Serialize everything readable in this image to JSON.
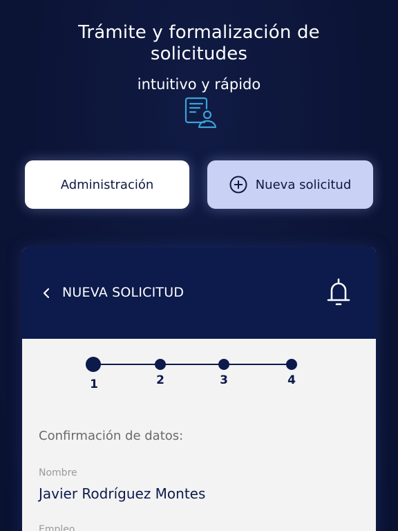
{
  "hero": {
    "title_line1": "Trámite y formalización de",
    "title_line2": "solicitudes",
    "subtitle": "intuitivo y rápido",
    "icon": "document-user-icon"
  },
  "actions": {
    "admin_label": "Administración",
    "new_label": "Nueva solicitud",
    "new_icon": "plus-circle-icon"
  },
  "card": {
    "header_title": "NUEVA SOLICITUD",
    "back_icon": "chevron-left-icon",
    "bell_icon": "bell-icon",
    "steps": [
      "1",
      "2",
      "3",
      "4"
    ],
    "current_step": 1,
    "section_title": "Confirmación de datos:",
    "fields": [
      {
        "label": "Nombre",
        "value": "Javier Rodríguez Montes"
      },
      {
        "label": "Empleo",
        "value": ""
      }
    ]
  },
  "colors": {
    "background": "#0c1436",
    "header": "#0c1a4c",
    "accent": "#3aa3d9",
    "secondary_button": "#c9d1f4"
  }
}
